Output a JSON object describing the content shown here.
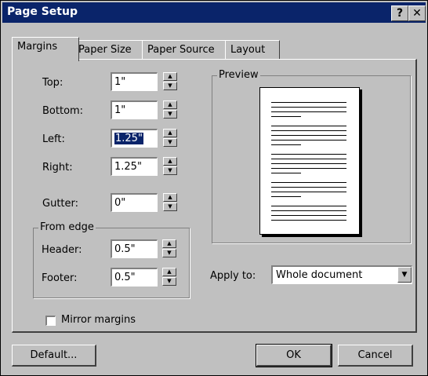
{
  "window": {
    "title": "Page Setup",
    "help_glyph": "?",
    "close_glyph": "✕"
  },
  "tabs": [
    {
      "label": "Margins",
      "active": true
    },
    {
      "label": "Paper Size",
      "active": false
    },
    {
      "label": "Paper Source",
      "active": false
    },
    {
      "label": "Layout",
      "active": false
    }
  ],
  "margins": {
    "top": {
      "label": "Top:",
      "value": "1\""
    },
    "bottom": {
      "label": "Bottom:",
      "value": "1\""
    },
    "left": {
      "label": "Left:",
      "value": "1.25\""
    },
    "right": {
      "label": "Right:",
      "value": "1.25\""
    },
    "gutter": {
      "label": "Gutter:",
      "value": "0\""
    }
  },
  "from_edge": {
    "legend": "From edge",
    "header": {
      "label": "Header:",
      "value": "0.5\""
    },
    "footer": {
      "label": "Footer:",
      "value": "0.5\""
    }
  },
  "preview": {
    "legend": "Preview"
  },
  "apply_to": {
    "label": "Apply to:",
    "value": "Whole document"
  },
  "mirror_margins": {
    "label": "Mirror margins",
    "checked": false
  },
  "buttons": {
    "default": "Default...",
    "ok": "OK",
    "cancel": "Cancel"
  },
  "icons": {
    "spin_up": "▲",
    "spin_down": "▼",
    "dropdown": "▼"
  }
}
